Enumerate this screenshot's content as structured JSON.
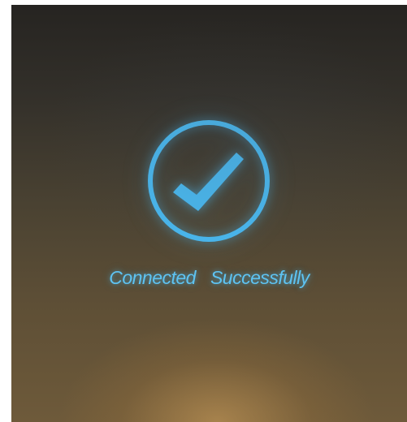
{
  "status": {
    "icon": "checkmark-circle-icon",
    "word_1": "Connected",
    "word_2": "Successfully"
  },
  "colors": {
    "accent": "#49B7EE",
    "background_top": "#262421",
    "background_bottom": "#6E5A3A"
  }
}
